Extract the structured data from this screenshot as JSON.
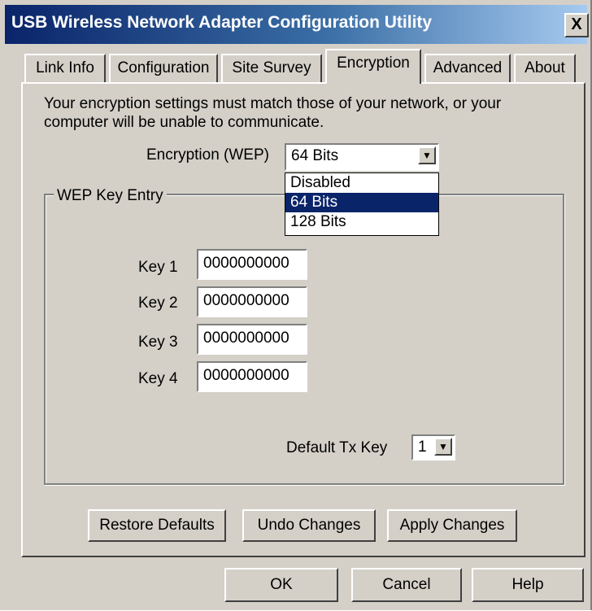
{
  "window": {
    "title": "USB Wireless Network Adapter Configuration Utility",
    "close_label": "X"
  },
  "tabs": [
    {
      "label": "Link Info"
    },
    {
      "label": "Configuration"
    },
    {
      "label": "Site Survey"
    },
    {
      "label": "Encryption",
      "active": true
    },
    {
      "label": "Advanced"
    },
    {
      "label": "About"
    }
  ],
  "encryption": {
    "info_text": "Your encryption settings must match those of your network, or your computer will be unable to communicate.",
    "wep_label": "Encryption (WEP)",
    "wep_value": "64 Bits",
    "dropdown_open": true,
    "options": [
      "Disabled",
      "64 Bits",
      "128 Bits"
    ],
    "selected_option": "64 Bits"
  },
  "wep_key_entry": {
    "group_label": "WEP Key Entry",
    "keys": [
      {
        "label": "Key 1",
        "value": "0000000000"
      },
      {
        "label": "Key 2",
        "value": "0000000000"
      },
      {
        "label": "Key 3",
        "value": "0000000000"
      },
      {
        "label": "Key 4",
        "value": "0000000000"
      }
    ],
    "default_tx_label": "Default Tx Key",
    "default_tx_value": "1"
  },
  "panel_buttons": {
    "restore": "Restore Defaults",
    "undo": "Undo Changes",
    "apply": "Apply Changes"
  },
  "dialog_buttons": {
    "ok": "OK",
    "cancel": "Cancel",
    "help": "Help"
  },
  "colors": {
    "face": "#d4d0c8",
    "title_start": "#0a246a",
    "title_end": "#a6caf0",
    "highlight": "#0a246a"
  }
}
